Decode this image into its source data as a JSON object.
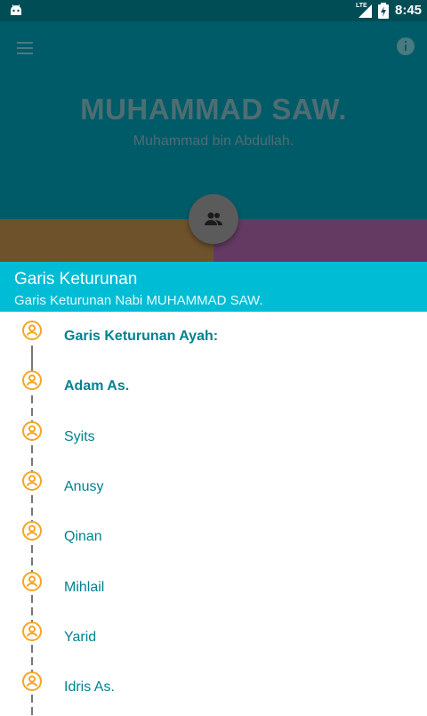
{
  "status_bar": {
    "time": "8:45",
    "network_label": "LTE",
    "icons": [
      "android-icon",
      "lte-signal-icon",
      "battery-charging-icon"
    ]
  },
  "app_bar": {
    "menu_icon": "hamburger-menu-icon",
    "info_icon": "info-icon",
    "title": "MUHAMMAD SAW.",
    "subtitle": "Muhammad bin Abdullah."
  },
  "fab": {
    "icon": "people-icon"
  },
  "colors": {
    "status_bar": "#004d56",
    "app_bar": "#005b68",
    "strip_left": "#6e522b",
    "strip_right": "#643a63",
    "fab": "#5b5b5b",
    "section_header": "#00bcd4",
    "node": "#f5a623",
    "item_text": "#00838f"
  },
  "section": {
    "title": "Garis Keturunan",
    "subtitle": "Garis Keturunan Nabi MUHAMMAD SAW."
  },
  "lineage": {
    "items": [
      {
        "label": "Garis Keturunan Ayah:",
        "bold": true
      },
      {
        "label": "Adam As.",
        "bold": true
      },
      {
        "label": "Syits",
        "bold": false
      },
      {
        "label": "Anusy",
        "bold": false
      },
      {
        "label": "Qinan",
        "bold": false
      },
      {
        "label": "Mihlail",
        "bold": false
      },
      {
        "label": "Yarid",
        "bold": false
      },
      {
        "label": "Idris As.",
        "bold": false
      }
    ]
  }
}
